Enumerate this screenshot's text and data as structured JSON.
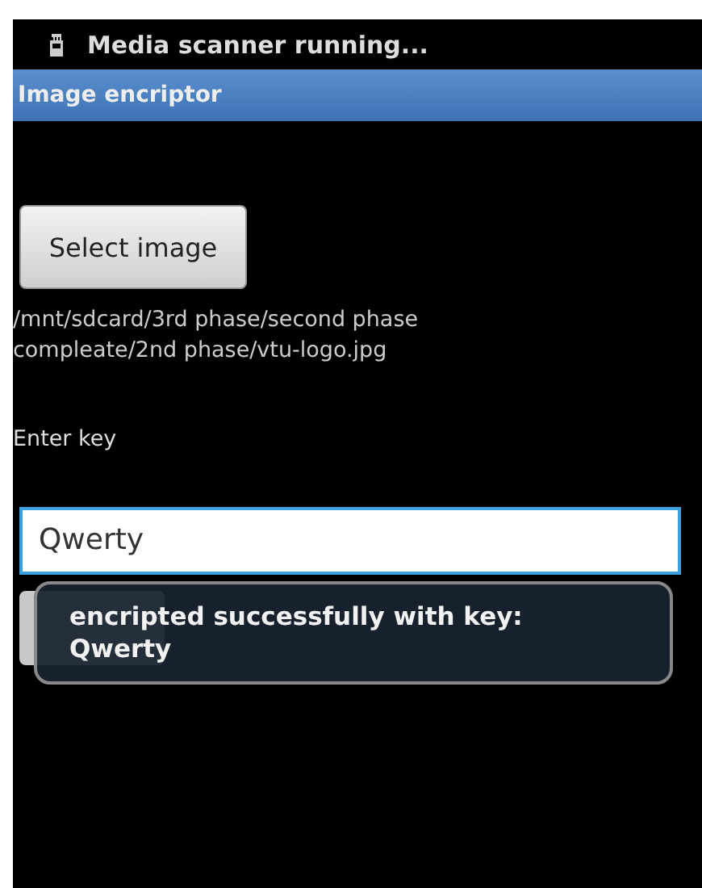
{
  "status_bar": {
    "notification": "Media scanner running..."
  },
  "title_bar": {
    "title": "Image encriptor"
  },
  "select_button": {
    "label": "Select image"
  },
  "file_path": "/mnt/sdcard/3rd phase/second phase compleate/2nd phase/vtu-logo.jpg",
  "key_label": "Enter key",
  "key_field": {
    "value": "Qwerty",
    "focused": true
  },
  "toast": {
    "message": "encripted successfully with key: Qwerty"
  }
}
